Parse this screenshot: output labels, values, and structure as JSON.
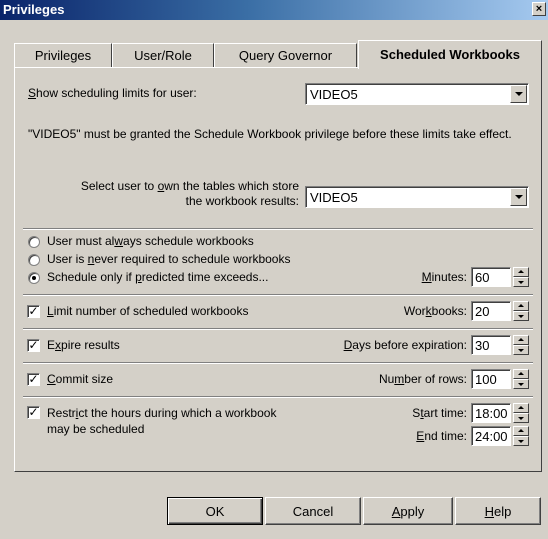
{
  "window": {
    "title": "Privileges",
    "close": "×"
  },
  "tabs": [
    {
      "label": "Privileges"
    },
    {
      "label": "User/Role"
    },
    {
      "label": "Query Governor"
    },
    {
      "label": "Scheduled Workbooks",
      "active": true
    }
  ],
  "show_limits": {
    "label_pre": "",
    "label_ul": "S",
    "label_post": "how scheduling limits for user:",
    "value": "VIDEO5"
  },
  "notice": "\"VIDEO5\" must be granted the Schedule Workbook privilege before these limits take effect.",
  "owner": {
    "label_line1_pre": "Select user to ",
    "label_line1_ul": "o",
    "label_line1_post": "wn the tables which store",
    "label_line2": "the workbook results:",
    "value": "VIDEO5"
  },
  "radios": [
    {
      "pre": "User must al",
      "ul": "w",
      "post": "ays schedule workbooks",
      "selected": false
    },
    {
      "pre": "User is ",
      "ul": "n",
      "post": "ever required to schedule workbooks",
      "selected": false
    },
    {
      "pre": "Schedule only if ",
      "ul": "p",
      "post": "redicted time exceeds...",
      "selected": true
    }
  ],
  "minutes": {
    "pre": "",
    "ul": "M",
    "post": "inutes:",
    "value": "60"
  },
  "limit_workbooks": {
    "check": "✓",
    "checked": true,
    "pre": "",
    "ul": "L",
    "post": "imit number of scheduled workbooks",
    "field_pre": "Wor",
    "field_ul": "k",
    "field_post": "books:",
    "value": "20"
  },
  "expire_results": {
    "check": "✓",
    "checked": true,
    "pre": "E",
    "ul": "x",
    "post": "pire results",
    "field_pre": "",
    "field_ul": "D",
    "field_post": "ays before expiration:",
    "value": "30"
  },
  "commit_size": {
    "check": "✓",
    "checked": true,
    "pre": "",
    "ul": "C",
    "post": "ommit size",
    "field_pre": "Nu",
    "field_ul": "m",
    "field_post": "ber of rows:",
    "value": "100"
  },
  "restrict_hours": {
    "check": "✓",
    "checked": true,
    "line1_pre": "Restr",
    "line1_ul": "i",
    "line1_post": "ct the hours during which a workbook",
    "line2": "may be scheduled",
    "start_pre": "S",
    "start_ul": "t",
    "start_post": "art time:",
    "start_value": "18:00",
    "end_pre": "",
    "end_ul": "E",
    "end_post": "nd time:",
    "end_value": "24:00"
  },
  "buttons": {
    "ok": "OK",
    "cancel": "Cancel",
    "apply_ul": "A",
    "apply_post": "pply",
    "help_ul": "H",
    "help_post": "elp"
  }
}
